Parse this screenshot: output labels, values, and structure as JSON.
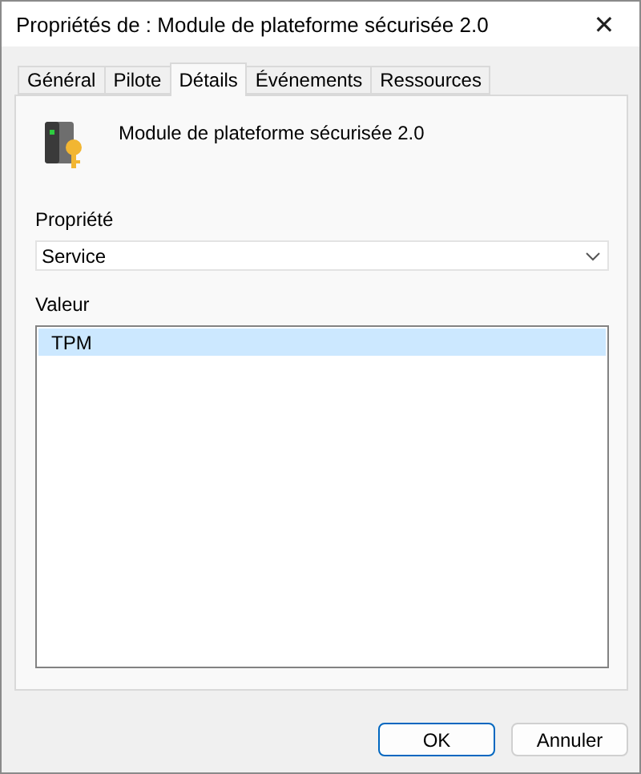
{
  "window": {
    "title": "Propriétés de : Module de plateforme sécurisée 2.0",
    "close": "✕"
  },
  "tabs": [
    {
      "label": "Général",
      "selected": false
    },
    {
      "label": "Pilote",
      "selected": false
    },
    {
      "label": "Détails",
      "selected": true
    },
    {
      "label": "Événements",
      "selected": false
    },
    {
      "label": "Ressources",
      "selected": false
    }
  ],
  "device": {
    "name": "Module de plateforme sécurisée 2.0"
  },
  "property": {
    "label": "Propriété",
    "value": "Service"
  },
  "value": {
    "label": "Valeur",
    "items": [
      {
        "text": "TPM",
        "selected": true
      }
    ]
  },
  "buttons": [
    {
      "label": "OK",
      "default": true
    },
    {
      "label": "Annuler",
      "default": false
    }
  ]
}
